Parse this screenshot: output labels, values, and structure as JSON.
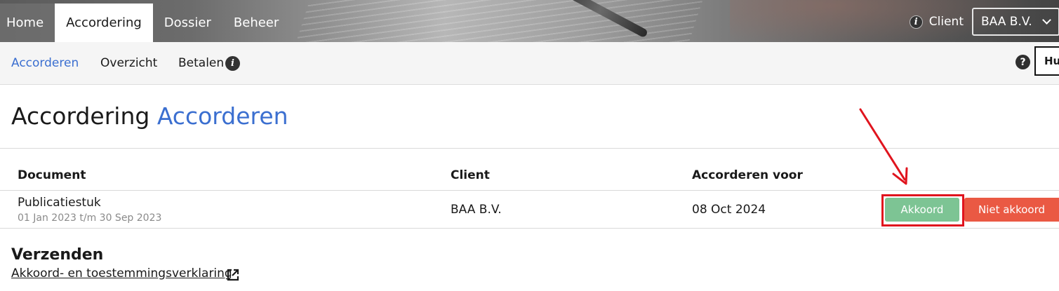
{
  "topnav": {
    "tabs": [
      {
        "label": "Home"
      },
      {
        "label": "Accordering"
      },
      {
        "label": "Dossier"
      },
      {
        "label": "Beheer"
      }
    ],
    "client_label": "Client",
    "client_selected": "BAA B.V.",
    "info_glyph": "i"
  },
  "subnav": {
    "items": [
      {
        "label": "Accorderen"
      },
      {
        "label": "Overzicht"
      },
      {
        "label": "Betalen"
      }
    ],
    "help_glyph": "?",
    "truncated_button": "Hu"
  },
  "page": {
    "title_main": "Accordering",
    "title_accent": "Accorderen"
  },
  "table": {
    "headers": [
      "Document",
      "Client",
      "Accorderen voor"
    ],
    "rows": [
      {
        "document": "Publicatiestuk",
        "period": "01 Jan 2023 t/m 30 Sep 2023",
        "client": "BAA B.V.",
        "deadline": "08 Oct 2024",
        "accept_label": "Akkoord",
        "reject_label": "Niet akkoord"
      }
    ]
  },
  "send": {
    "title": "Verzenden",
    "link_label": "Akkoord- en toestemmingsverklaring"
  },
  "colors": {
    "accent_blue": "#3b6fd0",
    "accept_green": "#7dc494",
    "reject_red": "#ea5943",
    "annotation_red": "#e0141e"
  },
  "icons": {
    "info": "info-icon",
    "help": "help-icon",
    "chevron": "chevron-down-icon",
    "external": "external-link-icon"
  }
}
